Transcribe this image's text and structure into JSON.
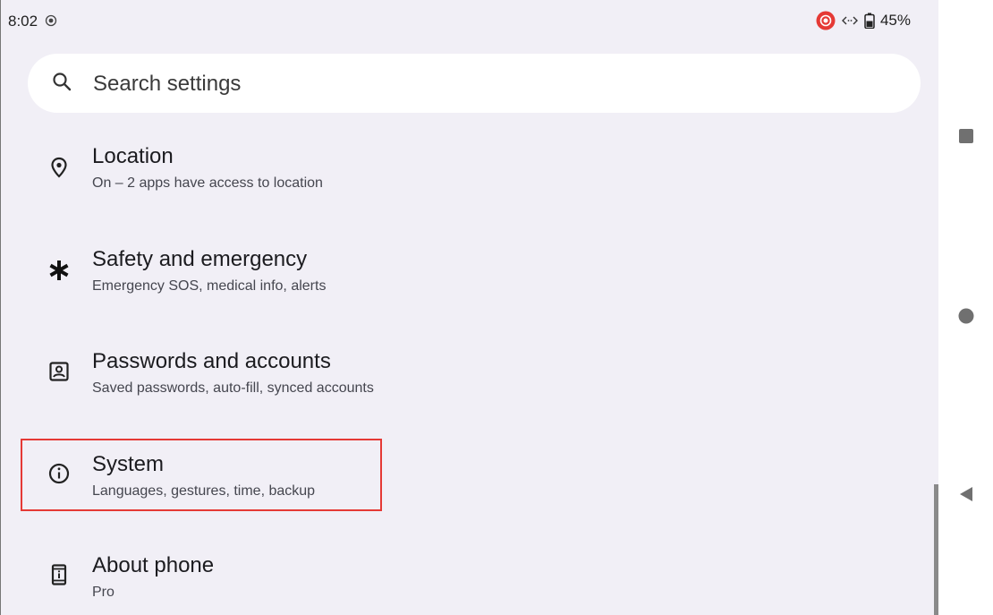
{
  "status_bar": {
    "time": "8:02",
    "battery": "45%",
    "record_color": "#e53935"
  },
  "search": {
    "placeholder": "Search settings",
    "value": ""
  },
  "settings_items": [
    {
      "title": "Location",
      "subtitle": "On – 2 apps have access to location",
      "icon": "location-pin-icon"
    },
    {
      "title": "Safety and emergency",
      "subtitle": "Emergency SOS, medical info, alerts",
      "icon": "asterisk-icon"
    },
    {
      "title": "Passwords and accounts",
      "subtitle": "Saved passwords, auto-fill, synced accounts",
      "icon": "account-box-icon"
    },
    {
      "title": "System",
      "subtitle": "Languages, gestures, time, backup",
      "icon": "info-icon"
    },
    {
      "title": "About phone",
      "subtitle": "Pro",
      "icon": "phone-info-icon"
    }
  ],
  "highlight": {
    "color": "#e53935",
    "target": "System"
  },
  "nav_bar": {
    "buttons": [
      "recents-button",
      "home-button",
      "back-button"
    ]
  },
  "colors": {
    "background": "#f1eff6",
    "search_background": "#ffffff",
    "title_text": "#1b1b1f",
    "subtitle_text": "#45464f"
  }
}
